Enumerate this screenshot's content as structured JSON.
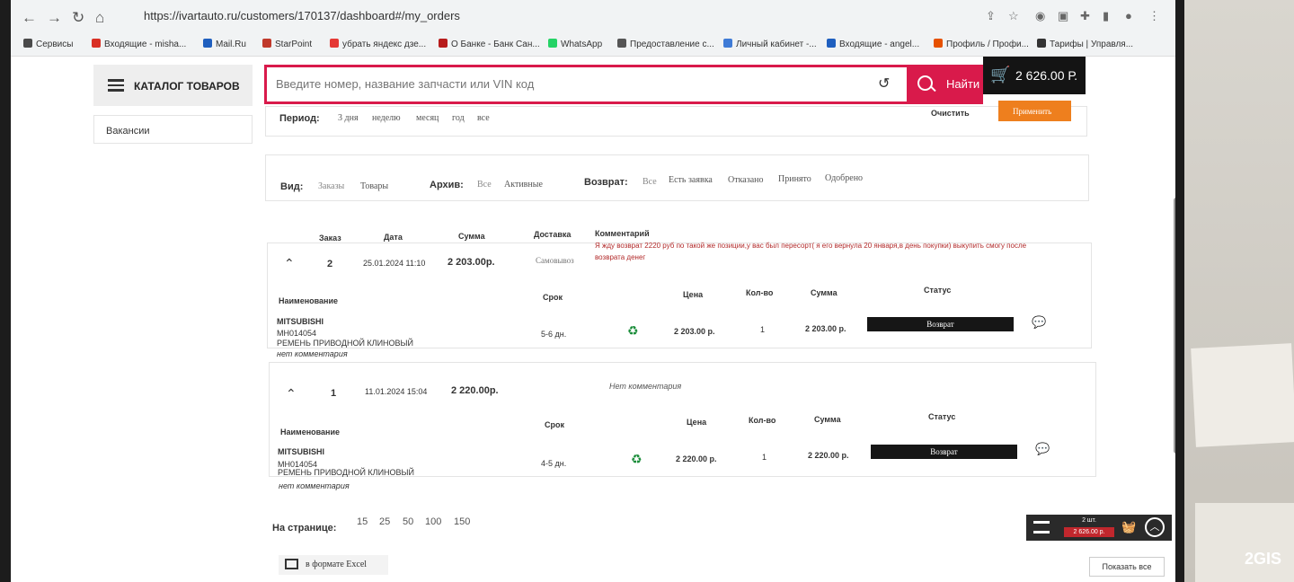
{
  "browser": {
    "url": "https://ivartauto.ru/customers/170137/dashboard#/my_orders",
    "bookmarks": [
      {
        "label": "Сервисы",
        "color": "#4a4a4a"
      },
      {
        "label": "Входящие - misha...",
        "color": "#d93025"
      },
      {
        "label": "Mail.Ru",
        "color": "#1f5fbf"
      },
      {
        "label": "StarPoint",
        "color": "#c0392b"
      },
      {
        "label": "убрать яндекс дзе...",
        "color": "#e53935"
      },
      {
        "label": "О Банке - Банк Сан...",
        "color": "#b71c1c"
      },
      {
        "label": "WhatsApp",
        "color": "#25d366"
      },
      {
        "label": "Предоставление с...",
        "color": "#555555"
      },
      {
        "label": "Личный кабинет -...",
        "color": "#3f7bd6"
      },
      {
        "label": "Входящие - angel...",
        "color": "#1f5fbf"
      },
      {
        "label": "Профиль / Профи...",
        "color": "#e65100"
      },
      {
        "label": "Тарифы | Управля...",
        "color": "#333333"
      }
    ]
  },
  "header": {
    "catalog_label": "КАТАЛОГ ТОВАРОВ",
    "search_placeholder": "Введите номер, название запчасти или VIN код",
    "find_label": "Найти",
    "cart_total": "2 626.00 Р."
  },
  "sidebar": {
    "vacancies": "Вакансии"
  },
  "filters": {
    "period_label": "Период:",
    "period_options": [
      "3 дня",
      "неделю",
      "месяц",
      "год",
      "все"
    ],
    "clear_label": "Очистить",
    "apply_label": "Применить",
    "view_label": "Вид:",
    "view_options": [
      "Заказы",
      "Товары"
    ],
    "archive_label": "Архив:",
    "archive_options": [
      "Все",
      "Активные"
    ],
    "return_label": "Возврат:",
    "return_options": [
      "Все",
      "Есть заявка",
      "Отказано",
      "Принято",
      "Одобрено"
    ]
  },
  "orders_header": {
    "order": "Заказ",
    "date": "Дата",
    "sum": "Сумма",
    "delivery": "Доставка",
    "comment": "Комментарий"
  },
  "items_header": {
    "name": "Наименование",
    "term": "Срок",
    "price": "Цена",
    "qty": "Кол-во",
    "sum": "Сумма",
    "status": "Статус"
  },
  "orders": [
    {
      "number": "2",
      "date": "25.01.2024 11:10",
      "sum": "2 203.00р.",
      "delivery": "Самовывоз",
      "comment": "Я жду возврат 2220 руб по такой же позиции,у вас был пересорт( я его вернула 20 января,в день покупки) выкупить смогу после возврата денег",
      "item": {
        "brand": "MITSUBISHI",
        "code": "MH014054",
        "title": "РЕМЕНЬ ПРИВОДНОЙ КЛИНОВЫЙ",
        "note": "нет комментария",
        "term": "5-6 дн.",
        "price": "2 203.00 р.",
        "qty": "1",
        "sum": "2 203.00 р.",
        "status": "Возврат"
      }
    },
    {
      "number": "1",
      "date": "11.01.2024 15:04",
      "sum": "2 220.00р.",
      "delivery": "",
      "comment": "Нет комментария",
      "item": {
        "brand": "MITSUBISHI",
        "code": "MH014054",
        "title": "РЕМЕНЬ ПРИВОДНОЙ КЛИНОВЫЙ",
        "note": "нет комментария",
        "term": "4-5 дн.",
        "price": "2 220.00 р.",
        "qty": "1",
        "sum": "2 220.00 р.",
        "status": "Возврат"
      }
    }
  ],
  "pagination": {
    "label": "На странице:",
    "sizes": [
      "15",
      "25",
      "50",
      "100",
      "150"
    ]
  },
  "footer": {
    "excel_label": "в формате Excel",
    "minicart_count": "2 шт.",
    "minicart_sum": "2 626.00 р.",
    "show_all": "Показать все"
  },
  "watermark": "2GIS"
}
